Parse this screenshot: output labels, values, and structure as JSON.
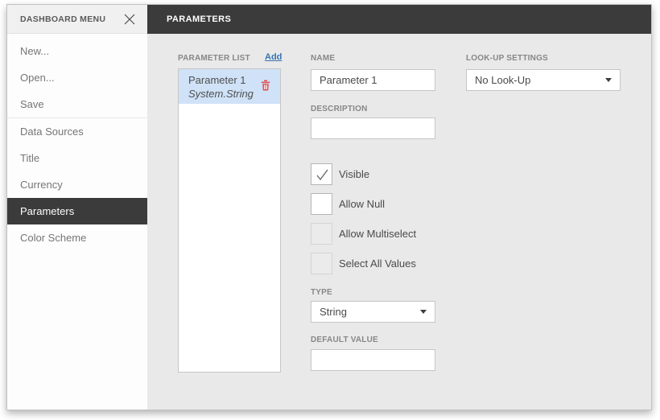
{
  "sidebar": {
    "title": "DASHBOARD MENU",
    "items": [
      {
        "label": "New..."
      },
      {
        "label": "Open..."
      },
      {
        "label": "Save"
      },
      {
        "label": "Data Sources"
      },
      {
        "label": "Title"
      },
      {
        "label": "Currency"
      },
      {
        "label": "Parameters"
      },
      {
        "label": "Color Scheme"
      }
    ],
    "selected_item": "Parameters"
  },
  "topbar": {
    "title": "PARAMETERS"
  },
  "parameter_list": {
    "title": "PARAMETER LIST",
    "add_label": "Add",
    "items": [
      {
        "name": "Parameter 1",
        "type": "System.String",
        "selected": true
      }
    ]
  },
  "form": {
    "name": {
      "label": "NAME",
      "value": "Parameter 1"
    },
    "lookup": {
      "label": "LOOK-UP SETTINGS",
      "value": "No Look-Up"
    },
    "description": {
      "label": "DESCRIPTION",
      "value": ""
    },
    "checkboxes": [
      {
        "label": "Visible",
        "checked": true,
        "disabled": false
      },
      {
        "label": "Allow Null",
        "checked": false,
        "disabled": false
      },
      {
        "label": "Allow Multiselect",
        "checked": false,
        "disabled": true
      },
      {
        "label": "Select All Values",
        "checked": false,
        "disabled": true
      }
    ],
    "type": {
      "label": "TYPE",
      "value": "String"
    },
    "default_value": {
      "label": "DEFAULT VALUE",
      "value": ""
    }
  },
  "colors": {
    "topbar_bg": "#3b3b3b",
    "selection_blue": "#cfe2f7",
    "link_blue": "#3673b3",
    "danger_red": "#db5151",
    "main_bg": "#e9e9e9"
  }
}
